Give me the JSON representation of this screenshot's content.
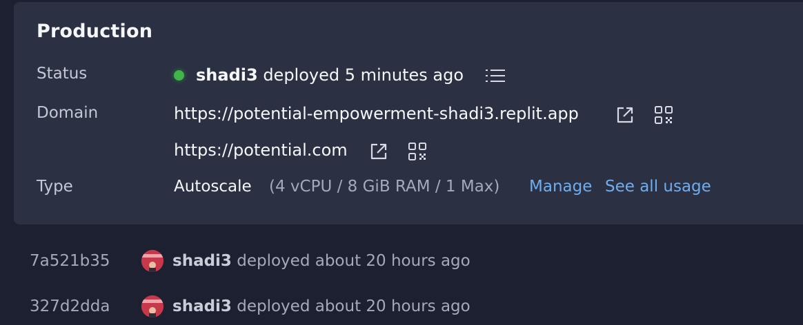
{
  "production": {
    "title": "Production",
    "status_label": "Status",
    "status_user": "shadi3",
    "status_text": "deployed 5 minutes ago",
    "status_color": "#3fb54a",
    "domain_label": "Domain",
    "domains": [
      "https://potential-empowerment-shadi3.replit.app",
      "https://potential.com"
    ],
    "type_label": "Type",
    "type_value": "Autoscale",
    "type_spec": "(4 vCPU / 8 GiB RAM / 1 Max)",
    "manage_label": "Manage",
    "see_usage_label": "See all usage",
    "link_color": "#6eaef0"
  },
  "history": [
    {
      "hash": "7a521b35",
      "user": "shadi3",
      "text": "deployed about 20 hours ago"
    },
    {
      "hash": "327d2dda",
      "user": "shadi3",
      "text": "deployed about 20 hours ago"
    }
  ],
  "icons": {
    "logs": "list-icon",
    "external": "external-link-icon",
    "qr": "qr-code-icon",
    "avatar": "avatar"
  }
}
